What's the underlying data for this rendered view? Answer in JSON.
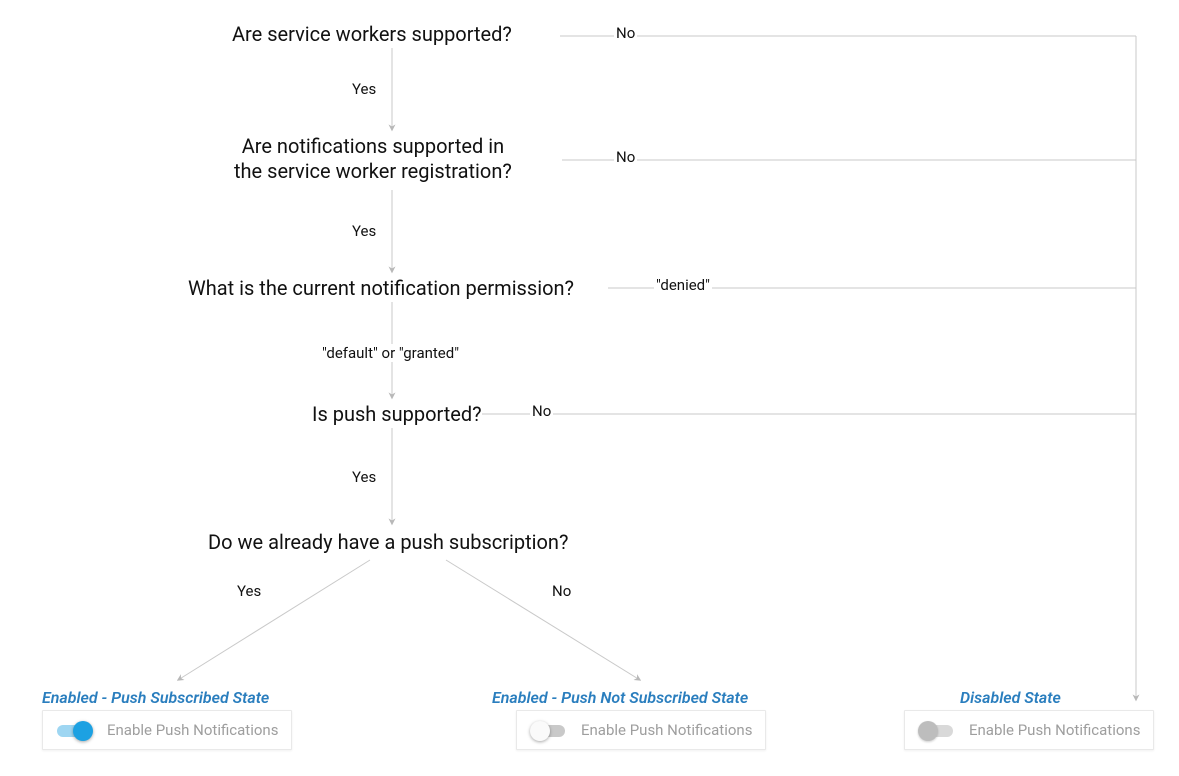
{
  "nodes": {
    "q1": "Are service workers supported?",
    "q2": "Are notifications supported in\nthe service worker registration?",
    "q3": "What is the current notification permission?",
    "q4": "Is push supported?",
    "q5": "Do we already have a push subscription?"
  },
  "labels": {
    "yes": "Yes",
    "no": "No",
    "default_or_granted": "\"default\" or \"granted\"",
    "denied": "\"denied\""
  },
  "states": {
    "subscribed": {
      "title": "Enabled - Push Subscribed State",
      "control_label": "Enable Push Notifications"
    },
    "not_subscribed": {
      "title": "Enabled - Push Not Subscribed State",
      "control_label": "Enable Push Notifications"
    },
    "disabled": {
      "title": "Disabled State",
      "control_label": "Enable Push Notifications"
    }
  },
  "chart_data": {
    "type": "flowchart",
    "nodes": [
      {
        "id": "q1",
        "label": "Are service workers supported?",
        "kind": "decision"
      },
      {
        "id": "q2",
        "label": "Are notifications supported in the service worker registration?",
        "kind": "decision"
      },
      {
        "id": "q3",
        "label": "What is the current notification permission?",
        "kind": "decision"
      },
      {
        "id": "q4",
        "label": "Is push supported?",
        "kind": "decision"
      },
      {
        "id": "q5",
        "label": "Do we already have a push subscription?",
        "kind": "decision"
      },
      {
        "id": "s_sub",
        "label": "Enabled - Push Subscribed State",
        "kind": "terminal",
        "ui": {
          "toggle": "on",
          "caption": "Enable Push Notifications"
        }
      },
      {
        "id": "s_unsub",
        "label": "Enabled - Push Not Subscribed State",
        "kind": "terminal",
        "ui": {
          "toggle": "off",
          "caption": "Enable Push Notifications"
        }
      },
      {
        "id": "s_dis",
        "label": "Disabled State",
        "kind": "terminal",
        "ui": {
          "toggle": "disabled",
          "caption": "Enable Push Notifications"
        }
      }
    ],
    "edges": [
      {
        "from": "q1",
        "to": "q2",
        "label": "Yes"
      },
      {
        "from": "q1",
        "to": "s_dis",
        "label": "No"
      },
      {
        "from": "q2",
        "to": "q3",
        "label": "Yes"
      },
      {
        "from": "q2",
        "to": "s_dis",
        "label": "No"
      },
      {
        "from": "q3",
        "to": "q4",
        "label": "\"default\" or \"granted\""
      },
      {
        "from": "q3",
        "to": "s_dis",
        "label": "\"denied\""
      },
      {
        "from": "q4",
        "to": "q5",
        "label": "Yes"
      },
      {
        "from": "q4",
        "to": "s_dis",
        "label": "No"
      },
      {
        "from": "q5",
        "to": "s_sub",
        "label": "Yes"
      },
      {
        "from": "q5",
        "to": "s_unsub",
        "label": "No"
      }
    ]
  }
}
